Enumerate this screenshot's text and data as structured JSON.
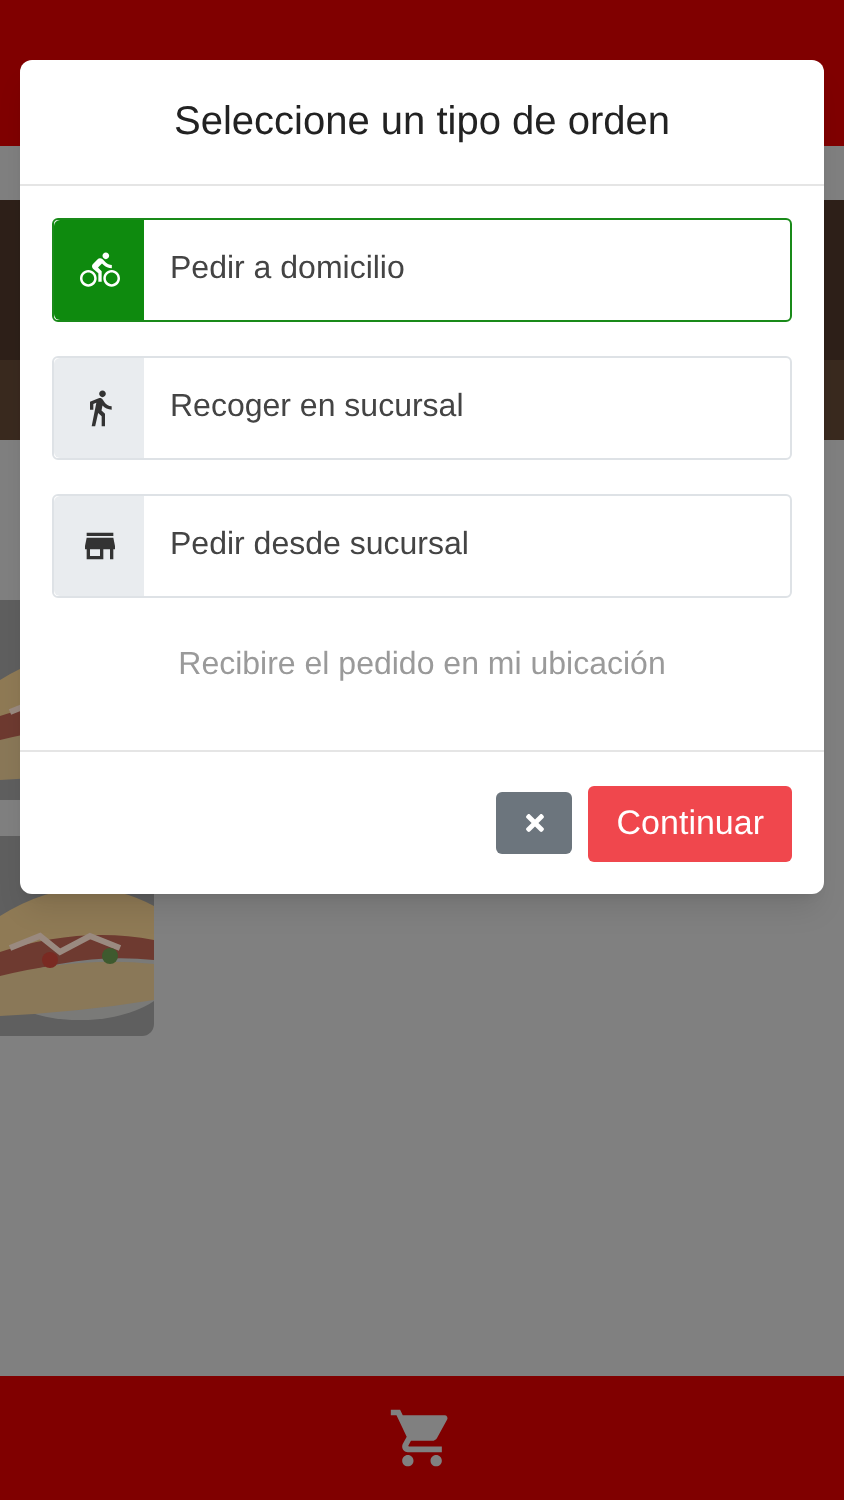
{
  "dialog": {
    "title": "Seleccione un tipo de orden",
    "options": [
      {
        "kind": "bike",
        "label": "Pedir a domicilio",
        "selected": true
      },
      {
        "kind": "walk",
        "label": "Recoger en sucursal",
        "selected": false
      },
      {
        "kind": "store",
        "label": "Pedir desde sucursal",
        "selected": false
      }
    ],
    "description": "Recibire el pedido en mi ubicación",
    "buttons": [
      {
        "kind": "close"
      },
      {
        "kind": "primary",
        "label": "Continuar"
      }
    ]
  }
}
